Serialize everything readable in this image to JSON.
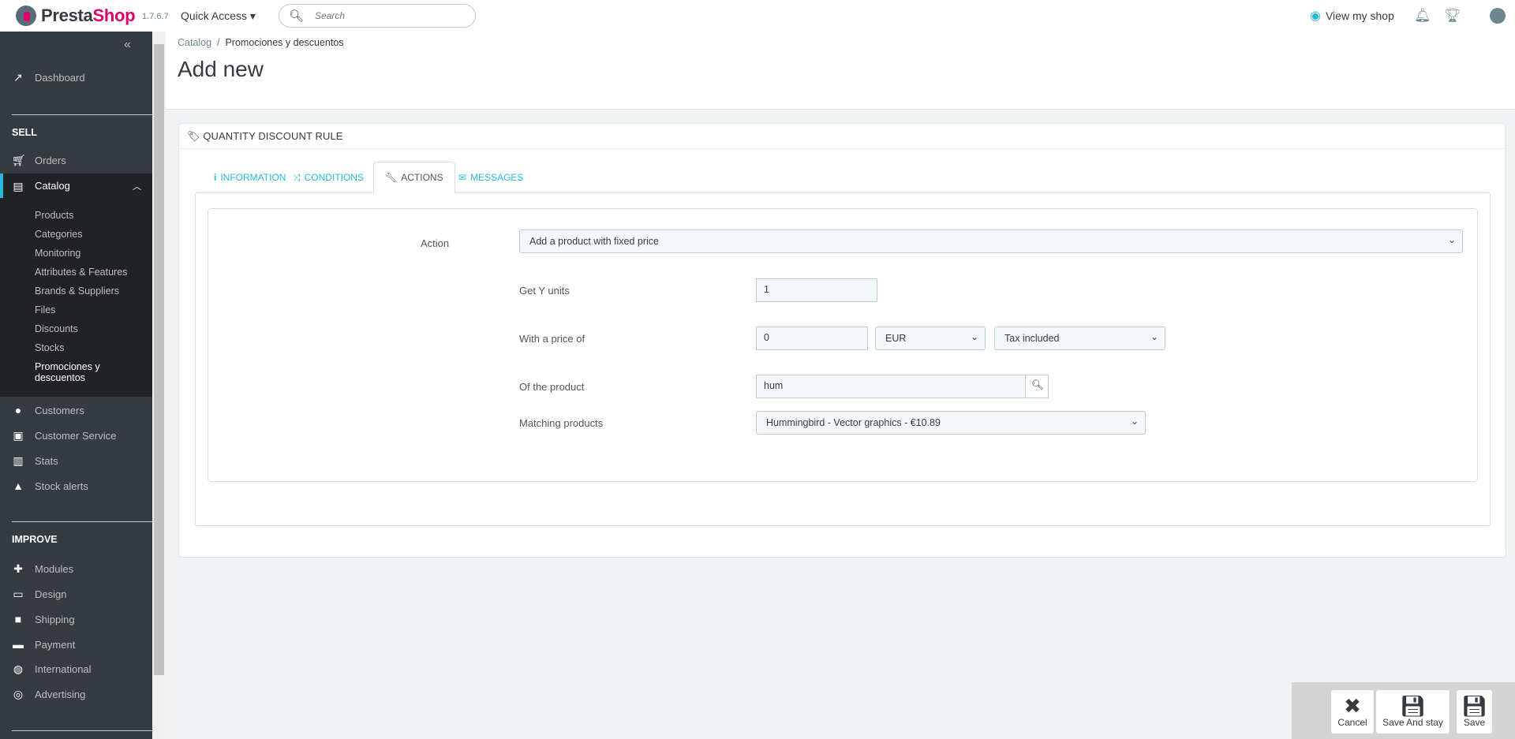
{
  "header": {
    "brand_left": "Presta",
    "brand_right": "Shop",
    "version": "1.7.6.7",
    "quick_access": "Quick Access",
    "search_placeholder": "Search",
    "view_shop": "View my shop"
  },
  "sidebar": {
    "dashboard": "Dashboard",
    "sell": "SELL",
    "orders": "Orders",
    "catalog": "Catalog",
    "catalog_sub": [
      "Products",
      "Categories",
      "Monitoring",
      "Attributes & Features",
      "Brands & Suppliers",
      "Files",
      "Discounts",
      "Stocks",
      "Promociones y descuentos"
    ],
    "customers": "Customers",
    "customer_service": "Customer Service",
    "stats": "Stats",
    "stock_alerts": "Stock alerts",
    "improve": "IMPROVE",
    "modules": "Modules",
    "design": "Design",
    "shipping": "Shipping",
    "payment": "Payment",
    "international": "International",
    "advertising": "Advertising"
  },
  "breadcrumb": {
    "parent": "Catalog",
    "sep": "/",
    "current": "Promociones y descuentos"
  },
  "page_title": "Add new",
  "panel": {
    "heading": "QUANTITY DISCOUNT RULE",
    "tabs": [
      "INFORMATION",
      "CONDITIONS",
      "ACTIONS",
      "MESSAGES"
    ],
    "form": {
      "action_label": "Action",
      "action_value": "Add a product with fixed price",
      "get_units_label": "Get Y units",
      "get_units_value": "1",
      "price_label": "With a price of",
      "price_value": "0",
      "currency": "EUR",
      "tax": "Tax included",
      "product_label": "Of the product",
      "product_value": "hum",
      "matching_label": "Matching products",
      "matching_value": "Hummingbird - Vector graphics - €10.89"
    }
  },
  "toolbar": {
    "cancel": "Cancel",
    "save_stay": "Save And stay",
    "save": "Save"
  },
  "colors": {
    "accent": "#25b9d7",
    "brand": "#df0067",
    "sidebar": "#363a41"
  }
}
